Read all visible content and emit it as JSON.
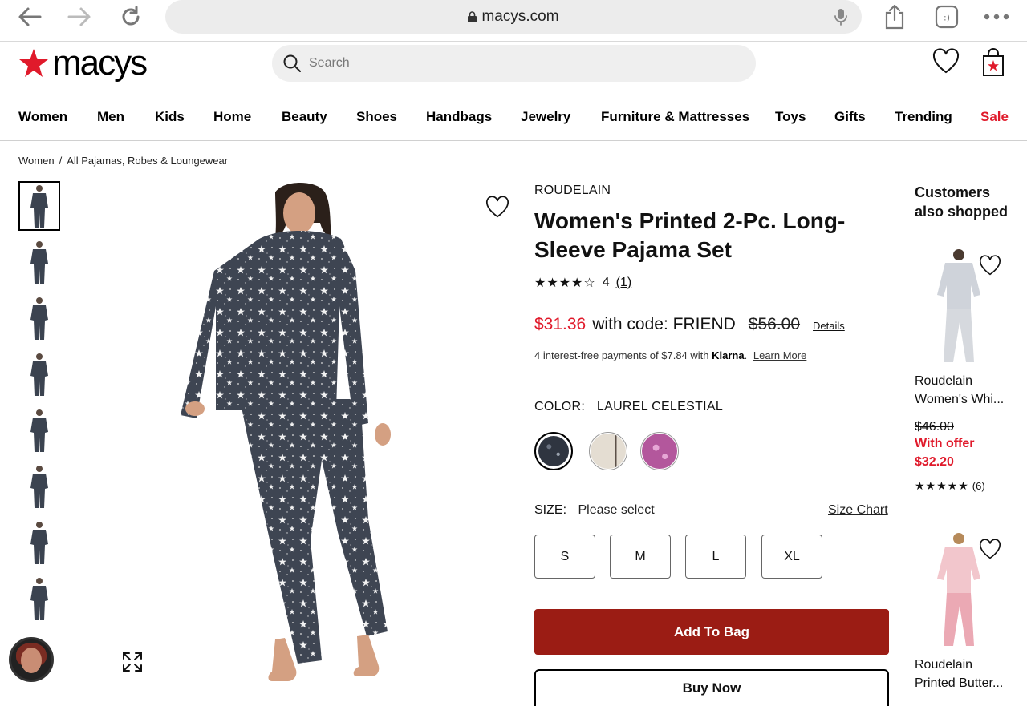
{
  "browser": {
    "url": "macys.com"
  },
  "header": {
    "logo_text": "macys",
    "search_placeholder": "Search"
  },
  "nav": {
    "items": [
      "Women",
      "Men",
      "Kids",
      "Home",
      "Beauty",
      "Shoes",
      "Handbags",
      "Jewelry",
      "Furniture & Mattresses",
      "Toys",
      "Gifts",
      "Trending",
      "Sale"
    ]
  },
  "breadcrumb": {
    "items": [
      "Women",
      "All Pajamas, Robes & Loungewear"
    ],
    "separator": "/"
  },
  "product": {
    "brand": "ROUDELAIN",
    "title": "Women's Printed 2-Pc. Long-Sleeve Pajama Set",
    "rating_stars": "★★★★☆",
    "rating_value": "4",
    "rating_count": "(1)",
    "sale_price": "$31.36",
    "code_text": "with code: FRIEND",
    "original_price": "$56.00",
    "details_label": "Details",
    "klarna_text": "4 interest-free payments of $7.84 with",
    "klarna_brand": "Klarna",
    "klarna_suffix": ".",
    "learn_more": "Learn More",
    "color_label": "COLOR:",
    "color_value": "LAUREL CELESTIAL",
    "size_label": "SIZE:",
    "size_value": "Please select",
    "size_chart": "Size Chart",
    "sizes": [
      "S",
      "M",
      "L",
      "XL"
    ],
    "add_to_bag": "Add To Bag",
    "buy_now": "Buy Now",
    "colors": {
      "sale_red": "#e01a2b",
      "add_bag_bg": "#9b1c14"
    }
  },
  "also_shopped": {
    "title": "Customers also shopped",
    "items": [
      {
        "brand": "Roudelain",
        "name": "Women's Whi...",
        "was_price": "$46.00",
        "offer_label": "With offer",
        "offer_price": "$32.20",
        "stars": "★★★★★",
        "reviews": "(6)"
      },
      {
        "brand": "Roudelain",
        "name": "Printed Butter..."
      }
    ]
  },
  "icons": [
    "back-arrow-icon",
    "forward-arrow-icon",
    "reload-icon",
    "lock-icon",
    "microphone-icon",
    "share-icon",
    "reader-icon",
    "more-icon",
    "search-icon",
    "heart-icon",
    "shopping-bag-icon",
    "expand-icon"
  ]
}
